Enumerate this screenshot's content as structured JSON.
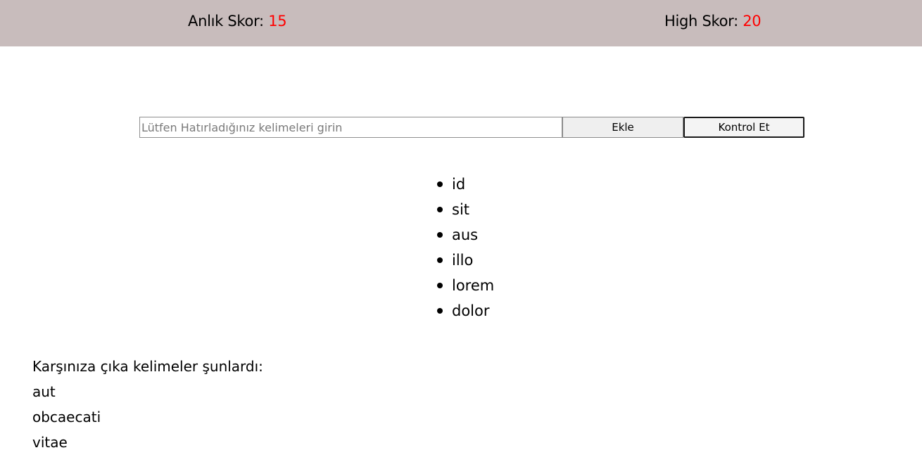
{
  "header": {
    "current_score": {
      "label": "Anlık Skor: ",
      "value": "15"
    },
    "high_score": {
      "label": "High Skor: ",
      "value": "20"
    }
  },
  "form": {
    "input_placeholder": "Lütfen Hatırladığınız kelimeleri girin",
    "input_value": "",
    "add_button": "Ekle",
    "check_button": "Kontrol Et"
  },
  "entered_words": [
    "id",
    "sit",
    "aus",
    "illo",
    "lorem",
    "dolor"
  ],
  "shown_words": {
    "title": "Karşınıza çıka kelimeler şunlardı:",
    "items": [
      "aut",
      "obcaecati",
      "vitae"
    ]
  },
  "colors": {
    "header_bg": "#c8bcbc",
    "score_value": "#ff0000"
  }
}
